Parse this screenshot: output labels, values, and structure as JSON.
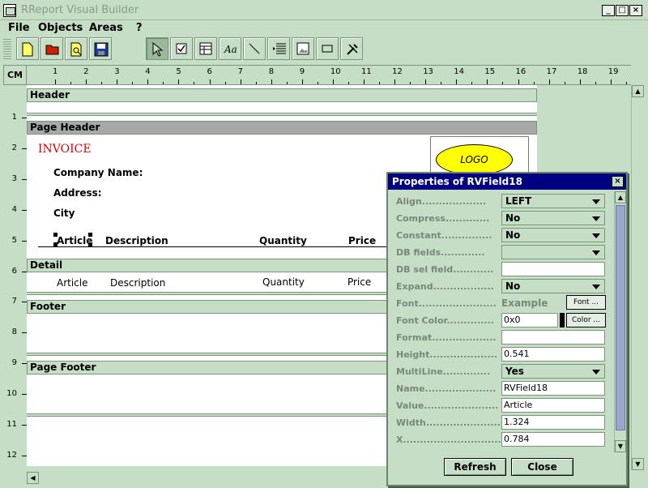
{
  "app": {
    "title": "RReport Visual Builder"
  },
  "menu": [
    "File",
    "Objects",
    "Areas",
    "?"
  ],
  "ruler": {
    "unit": "CM",
    "h_numbers": [
      "1",
      "2",
      "3",
      "4",
      "5",
      "6",
      "7",
      "8",
      "9",
      "10",
      "11",
      "12",
      "13",
      "14",
      "15",
      "16",
      "17",
      "18",
      "19"
    ],
    "v_numbers": [
      "1",
      "2",
      "3",
      "4",
      "5",
      "6",
      "7",
      "8",
      "9",
      "10",
      "11",
      "12"
    ]
  },
  "report": {
    "bands": {
      "header": "Header",
      "page_header": "Page Header",
      "detail": "Detail",
      "footer": "Footer",
      "page_footer": "Page Footer"
    },
    "invoice": "INVOICE",
    "logo": "LOGO",
    "company": "Company Name:",
    "address": "Address:",
    "city": "City",
    "columns": [
      "Article",
      "Description",
      "Quantity",
      "Price"
    ],
    "detail_values": [
      "Article",
      "Description",
      "Quantity",
      "Price"
    ]
  },
  "properties": {
    "title": "Properties of RVField18",
    "rows": [
      {
        "label": "Align...................",
        "kind": "select",
        "value": "LEFT"
      },
      {
        "label": "Compress.............",
        "kind": "select",
        "value": "No"
      },
      {
        "label": "Constant...............",
        "kind": "select",
        "value": "No"
      },
      {
        "label": "DB fields.............",
        "kind": "select",
        "value": ""
      },
      {
        "label": "DB sel field............",
        "kind": "input",
        "value": ""
      },
      {
        "label": "Expand..................",
        "kind": "select",
        "value": "No"
      },
      {
        "label": "Font.......................",
        "kind": "font",
        "value": "Example"
      },
      {
        "label": "Font Color..............",
        "kind": "color",
        "value": "0x0"
      },
      {
        "label": "Format...................",
        "kind": "input",
        "value": ""
      },
      {
        "label": "Height....................",
        "kind": "input",
        "value": "0.541"
      },
      {
        "label": "MultiLine..............",
        "kind": "select",
        "value": "Yes"
      },
      {
        "label": "Name.....................",
        "kind": "input",
        "value": "RVField18"
      },
      {
        "label": "Value......................",
        "kind": "input",
        "value": "Article"
      },
      {
        "label": "Width......................",
        "kind": "input",
        "value": "1.324"
      },
      {
        "label": "X..............................",
        "kind": "input",
        "value": "0.784"
      }
    ],
    "font_button": "Font ...",
    "color_button": "Color ...",
    "refresh": "Refresh",
    "close": "Close"
  }
}
